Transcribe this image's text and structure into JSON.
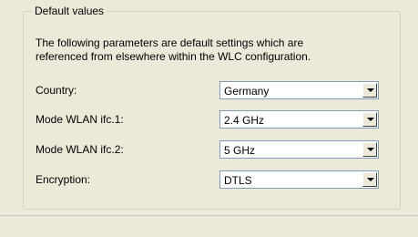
{
  "group": {
    "title": "Default values",
    "description_line1": "The following parameters are default settings which are",
    "description_line2": "referenced from elsewhere within the WLC configuration."
  },
  "fields": [
    {
      "label": "Country:",
      "value": "Germany"
    },
    {
      "label": "Mode WLAN ifc.1:",
      "value": "2.4 GHz"
    },
    {
      "label": "Mode WLAN ifc.2:",
      "value": "5 GHz"
    },
    {
      "label": "Encryption:",
      "value": "DTLS"
    }
  ],
  "icons": {
    "dropdown": "chevron-down-icon"
  }
}
